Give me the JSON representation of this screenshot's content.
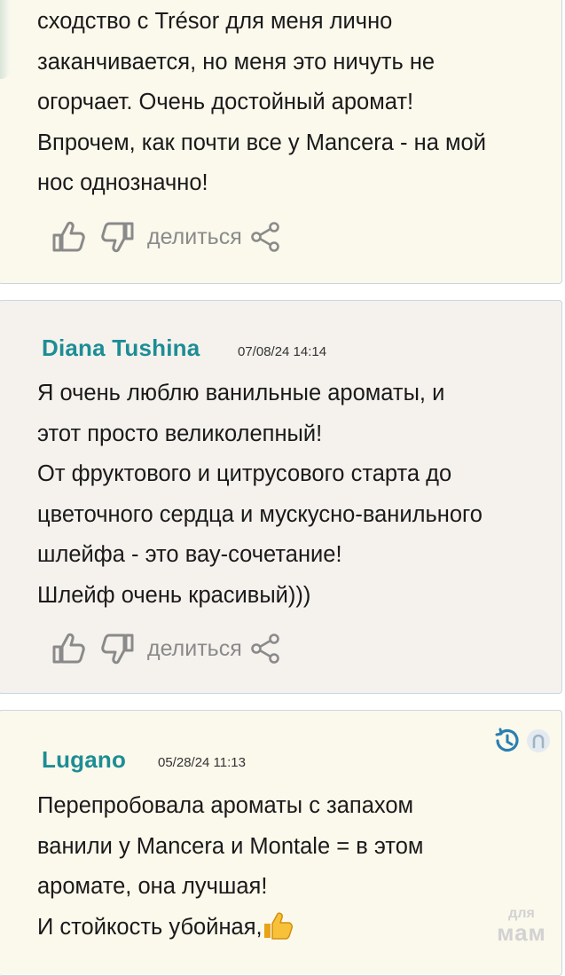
{
  "reviews": [
    {
      "lines": [
        "сходство с Trésor для меня лично",
        "заканчивается, но меня это ничуть не",
        "огорчает. Очень достойный аромат!",
        "Впрочем, как почти все у Mancera - на мой",
        "нос однозначно!"
      ],
      "share_label": "делиться"
    },
    {
      "author": "Diana Tushina",
      "date": "07/08/24 14:14",
      "lines": [
        "Я очень люблю ванильные ароматы, и",
        "этот просто великолепный!",
        "От фруктового и цитрусового старта до",
        "цветочного сердца и мускусно-ванильного",
        "шлейфа - это вау-сочетание!",
        "Шлейф очень красивый)))"
      ],
      "share_label": "делиться"
    },
    {
      "author": "Lugano",
      "date": "05/28/24 11:13",
      "lines": [
        "Перепробовала ароматы с запахом",
        "ванили у Mancera и Montale = в этом",
        "аромате, она лучшая!",
        "И стойкость убойная,"
      ]
    }
  ],
  "watermark": {
    "top": "для",
    "bottom": "мам"
  },
  "icons": {
    "like": "thumb-up-icon",
    "dislike": "thumb-down-icon",
    "share": "share-icon",
    "history": "clock-history-icon",
    "user": "user-avatar-icon",
    "emoji": "thumbs-up-emoji"
  },
  "colors": {
    "author": "#1d8d95",
    "icon_gray": "#8a8a8a",
    "card_cream": "#fbf8ec",
    "card_gray": "#f5f2ee",
    "card_border": "#c9d6e2"
  }
}
